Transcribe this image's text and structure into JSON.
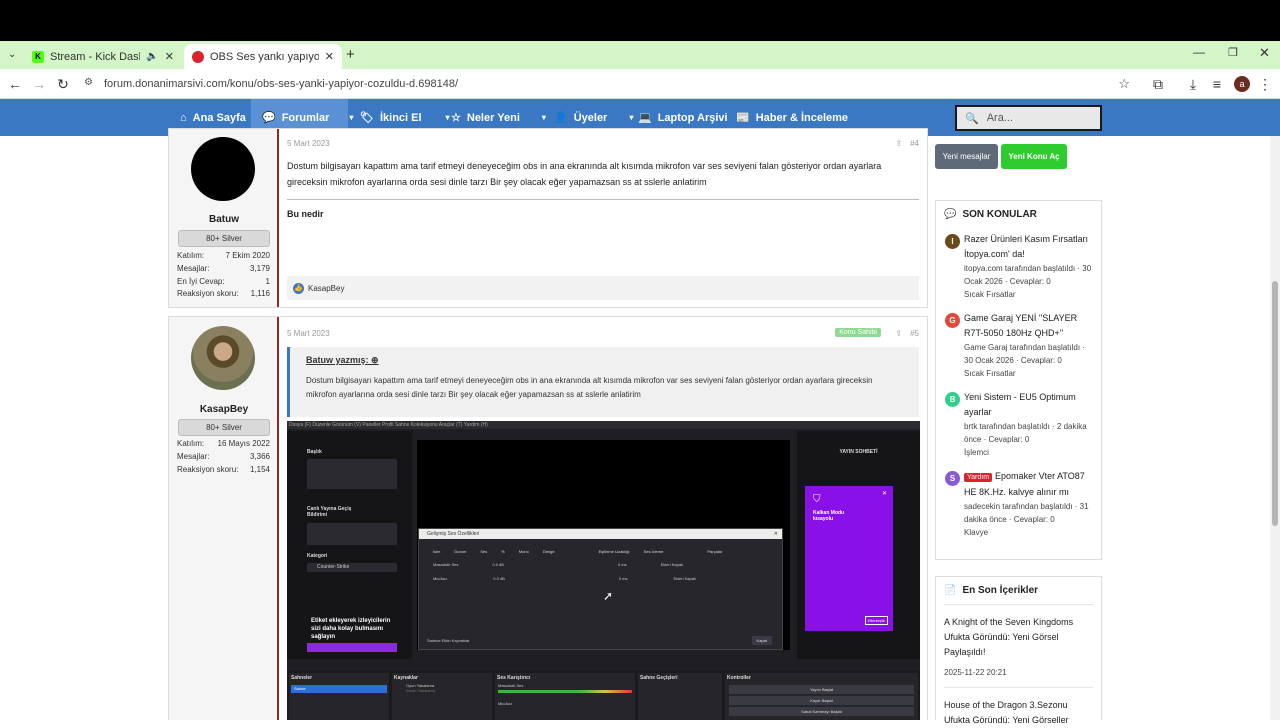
{
  "browser": {
    "tabs": [
      {
        "title": "Stream - Kick Dashboard",
        "favicon": "kick-icon",
        "accent": "#53fc18"
      },
      {
        "title": "OBS Ses yankı yapıyor. ÇÖZÜLDÜ",
        "favicon": "donanimarsivi-icon",
        "accent": "#d9232d"
      }
    ],
    "url": "forum.donanimarsivi.com/konu/obs-ses-yanki-yapiyor-cozuldu-d.698148/",
    "profile_initial": "a"
  },
  "nav": {
    "items": [
      "Ana Sayfa",
      "Forumlar",
      "İkinci El",
      "Neler Yeni",
      "Üyeler",
      "Laptop Arşivi",
      "Haber & İnceleme"
    ],
    "search_placeholder": "Ara..."
  },
  "posts": [
    {
      "date": "5 Mart 2023",
      "number": "#4",
      "user": {
        "name": "Batuw",
        "rank": "80+ Silver",
        "stats": [
          [
            "Katılım:",
            "7 Ekim 2020"
          ],
          [
            "Mesajlar:",
            "3,179"
          ],
          [
            "En İyi Cevap:",
            "1"
          ],
          [
            "Reaksiyon skoru:",
            "1,116"
          ]
        ]
      },
      "text": "Dostum bilgisayarı kapattım ama tarif etmeyi deneyeceğim obs in ana ekranında alt kısımda mikrofon var ses seviyeni falan gösteriyor ordan ayarlara gireceksin mikrofon ayarlarına orda sesi dinle tarzı Bir şey olacak eğer yapamazsan ss at sslerle anlatirim",
      "reply": "Bu nedir",
      "reaction_user": "KasapBey"
    },
    {
      "date": "5 Mart 2023",
      "number": "#5",
      "badge": "Konu Sahibi",
      "user": {
        "name": "KasapBey",
        "rank": "80+ Silver",
        "stats": [
          [
            "Katılım:",
            "16 Mayıs 2022"
          ],
          [
            "Mesajlar:",
            "3,366"
          ],
          [
            "Reaksiyon skoru:",
            "1,154"
          ]
        ]
      },
      "quote_author": "Batuw yazmış:",
      "quote_text": "Dostum bilgisayarı kapattım ama tarif etmeyi deneyeceğim obs in ana ekranında alt kısımda mikrofon var ses seviyeni falan gösteriyor ordan ayarlara gireceksin mikrofon ayarlarına orda sesi dinle tarzı Bir şey olacak eğer yapamazsan ss at sslerle anlatirim"
    }
  ],
  "sidebar": {
    "new_posts": "Yeni mesajlar",
    "new_thread": "Yeni Konu Aç",
    "recent_title": "SON KONULAR",
    "threads": [
      {
        "title": "Razer Ürünleri Kasım Fırsatları İtopya.com' da!",
        "meta": "itopya.com tarafından başlatıldı · 30 Ocak 2026 · Cevaplar: 0",
        "forum": "Sıcak Fırsatlar",
        "icon_color": "#6b4a1a",
        "icon": "I"
      },
      {
        "title": "Game Garaj YENİ ''SLAYER R7T-5050 180Hz QHD+''",
        "meta": "Game Garaj tarafından başlatıldı · 30 Ocak 2026 · Cevaplar: 0",
        "forum": "Sıcak Fırsatlar",
        "icon_color": "#e04a3a",
        "icon": "G"
      },
      {
        "title": "Yeni Sistem - EU5 Optimum ayarlar",
        "meta": "brtk tarafından başlatıldı · 2 dakika önce · Cevaplar: 0",
        "forum": "İşlemci",
        "icon_color": "#2fcf8a",
        "icon": "B"
      },
      {
        "prefix": "Yardım",
        "title": "Epomaker Vter ATO87 HE 8K.Hz. kalvye alınır mı",
        "meta": "sadecekin tarafından başlatıldı · 31 dakika önce · Cevaplar: 0",
        "forum": "Klavye",
        "icon_color": "#8a5ad0",
        "icon": "S"
      }
    ],
    "latest_title": "En Son İçerikler",
    "latest": [
      {
        "title": "A Knight of the Seven Kingdoms Ufukta Göründü: Yeni Görsel Paylaşıldı!",
        "date": "2025-11-22 20:21"
      },
      {
        "title": "House of the Dragon 3.Sezonu Ufukta Göründü: Yeni Görseller"
      }
    ]
  },
  "obs": {
    "menu": "Dosya (F)   Düzenle   Görünüm (V)   Paneller   Profil   Sahne Koleksiyonu   Araçlar (T)   Yardım (H)",
    "dialog_title": "Gelişmiş Ses Özellikleri",
    "headers": [
      "İsim",
      "Durum",
      "Ses",
      "%",
      "Mono",
      "Denge",
      "Eşitleme Uzaklığı",
      "Ses İzleme",
      "Parçalar"
    ],
    "rows": [
      [
        "Masaüstü Ses",
        "0.0 dB",
        "0 ms",
        "Ekleri Kapalı"
      ],
      [
        "Mic/Aux",
        "0.0 dB",
        "0 ms",
        "Ekleri Kapalı"
      ]
    ],
    "dialog_footer": "Sadece Etkin Kaynaklar",
    "close": "Kapat",
    "panels": [
      "Sahneler",
      "Kaynaklar",
      "Ses Karıştırıcı",
      "Sahne Geçişleri",
      "Kontroller"
    ],
    "scene": "Sahne",
    "sources": [
      "Oyun Yakalama",
      "Ekran Yakalama"
    ],
    "mixer": [
      "Masaüstü Ses",
      "Mic/Aux"
    ],
    "controls": [
      "Yayını Başlat",
      "Kaydı Başlat",
      "Sanal Kamerayı Başlat"
    ],
    "chat_title": "YAYIN SOHBETİ",
    "kick_title": "Kalkan Modu kısayolu",
    "kick_button": "Etkinleştir",
    "sidebar_labels": [
      "Başlık",
      "Canlı Yayına Geçiş Bildirimi",
      "Kategori"
    ],
    "category": "Counter-Strike",
    "overlay_text": "Etiket ekleyerek izleyicilerin sizi daha kolay bulmasını sağlayın"
  }
}
